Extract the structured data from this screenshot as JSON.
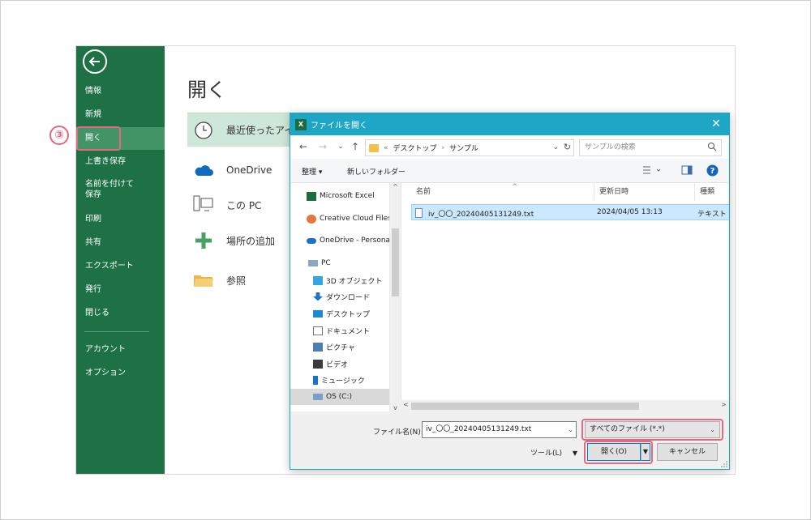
{
  "step_marker": "③",
  "backstage": {
    "title": "開く",
    "nav": [
      {
        "label": "情報"
      },
      {
        "label": "新規"
      },
      {
        "label": "開く"
      },
      {
        "label": "上書き保存"
      },
      {
        "label": "名前を付けて\n保存"
      },
      {
        "label": "印刷"
      },
      {
        "label": "共有"
      },
      {
        "label": "エクスポート"
      },
      {
        "label": "発行"
      },
      {
        "label": "閉じる"
      },
      {
        "label": "アカウント"
      },
      {
        "label": "オプション"
      }
    ],
    "locations": [
      {
        "label": "最近使ったアイテム"
      },
      {
        "label": "OneDrive"
      },
      {
        "label": "この PC"
      },
      {
        "label": "場所の追加"
      },
      {
        "label": "参照"
      }
    ]
  },
  "dialog": {
    "title": "ファイルを開く",
    "title_icon": "X",
    "address": {
      "prefix": "«",
      "crumbs": [
        "デスクトップ",
        "サンプル"
      ]
    },
    "search_placeholder": "サンプルの検索",
    "toolbar": {
      "organize": "整理 ▾",
      "new_folder": "新しいフォルダー"
    },
    "tree": [
      {
        "label": "Microsoft Excel"
      },
      {
        "label": "Creative Cloud Files"
      },
      {
        "label": "OneDrive - Personal"
      },
      {
        "label": "PC"
      },
      {
        "label": "3D オブジェクト"
      },
      {
        "label": "ダウンロード"
      },
      {
        "label": "デスクトップ"
      },
      {
        "label": "ドキュメント"
      },
      {
        "label": "ピクチャ"
      },
      {
        "label": "ビデオ"
      },
      {
        "label": "ミュージック"
      },
      {
        "label": "OS (C:)"
      }
    ],
    "columns": {
      "name": "名前",
      "modified": "更新日時",
      "type": "種類"
    },
    "files": [
      {
        "name": "iv_〇〇_20240405131249.txt",
        "modified": "2024/04/05 13:13",
        "type": "テキスト ド"
      }
    ],
    "filename_label": "ファイル名(N):",
    "filename_value": "iv_〇〇_20240405131249.txt",
    "filetype_value": "すべてのファイル (*.*)",
    "tools_label": "ツール(L)",
    "open_label": "開く(O)",
    "cancel_label": "キャンセル"
  },
  "colors": {
    "excel_green": "#1e7145",
    "dialog_accent": "#1ea6c6",
    "highlight": "#e4687e"
  }
}
